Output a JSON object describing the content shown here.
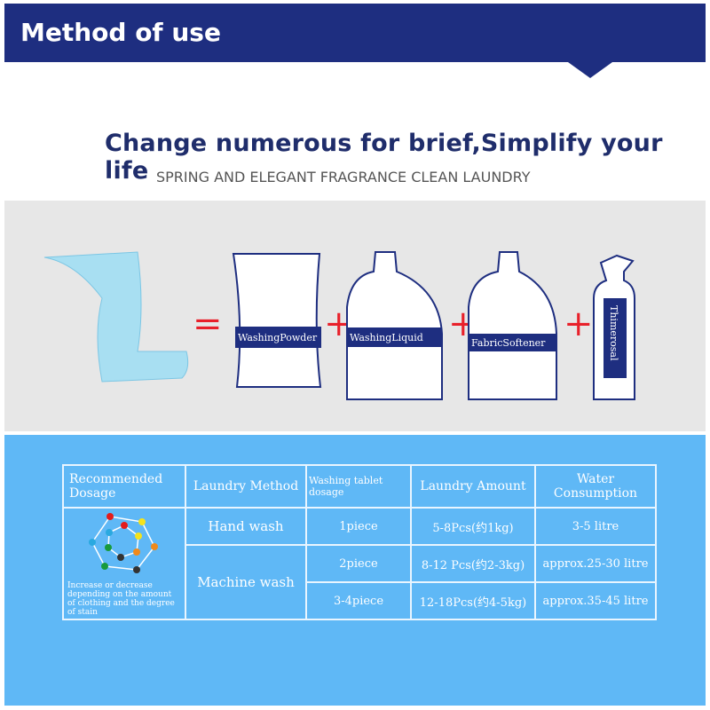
{
  "header": {
    "title": "Method of use"
  },
  "headline": "Change numerous for brief,Simplify your life",
  "subheadline": "SPRING AND ELEGANT FRAGRANCE CLEAN LAUNDRY",
  "products": {
    "equals": "=",
    "plus": "+",
    "items": [
      "WashingPowder",
      "WashingLiquid",
      "FabricSoftener",
      "Thimerosal"
    ]
  },
  "colors": {
    "header": "#1e2e80",
    "panel": "#5fb8f6",
    "accent_red": "#e8202a"
  },
  "table": {
    "headers": [
      "Recommended Dosage",
      "Laundry Method",
      "Washing tablet dosage",
      "Laundry Amount",
      "Water Consumption"
    ],
    "note": "Increase or decrease depending on the amount of clothing and the degree of stain",
    "methods": [
      "Hand wash",
      "Machine wash"
    ],
    "rows": [
      {
        "dosage": "1piece",
        "amount": "5-8Pcs(约1kg)",
        "water": "3-5 litre"
      },
      {
        "dosage": "2piece",
        "amount": "8-12 Pcs(约2-3kg)",
        "water": "approx.25-30 litre"
      },
      {
        "dosage": "3-4piece",
        "amount": "12-18Pcs(约4-5kg)",
        "water": "approx.35-45 litre"
      }
    ]
  }
}
